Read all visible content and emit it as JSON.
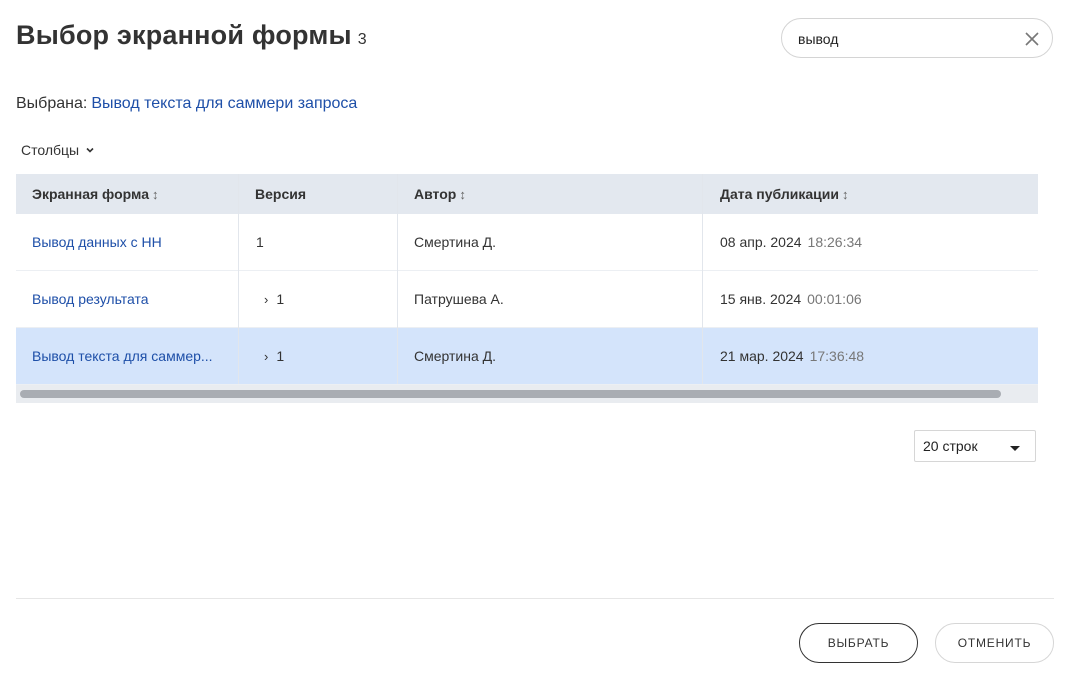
{
  "dialog": {
    "title": "Выбор экранной формы",
    "count": "3"
  },
  "search": {
    "value": "вывод",
    "clear_icon": "close-icon"
  },
  "selected": {
    "label": "Выбрана:",
    "value": "Вывод текста для саммери запроса"
  },
  "columns_button": {
    "label": "Столбцы",
    "icon": "chevron-down-icon"
  },
  "table": {
    "headers": [
      {
        "label": "Экранная форма",
        "sortable": true
      },
      {
        "label": "Версия",
        "sortable": false
      },
      {
        "label": "Автор",
        "sortable": true
      },
      {
        "label": "Дата публикации",
        "sortable": true
      }
    ],
    "sort_glyph": "↕",
    "expand_glyph": "›",
    "rows": [
      {
        "form": "Вывод данных с НН",
        "version": "1",
        "expandable": false,
        "author": "Смертина Д.",
        "date": "08 апр. 2024",
        "time": "18:26:34",
        "selected": false
      },
      {
        "form": "Вывод результата",
        "version": "1",
        "expandable": true,
        "author": "Патрушева А.",
        "date": "15 янв. 2024",
        "time": "00:01:06",
        "selected": false
      },
      {
        "form": "Вывод текста для саммер...",
        "version": "1",
        "expandable": true,
        "author": "Смертина Д.",
        "date": "21 мар. 2024",
        "time": "17:36:48",
        "selected": true
      }
    ]
  },
  "pagination": {
    "rows_per_page": "20 строк"
  },
  "footer": {
    "select_label": "ВЫБРАТЬ",
    "cancel_label": "ОТМЕНИТЬ"
  },
  "colors": {
    "link": "#1e4fa8",
    "selected_row": "#d4e4fb",
    "header_bg": "#e3e8ef"
  }
}
